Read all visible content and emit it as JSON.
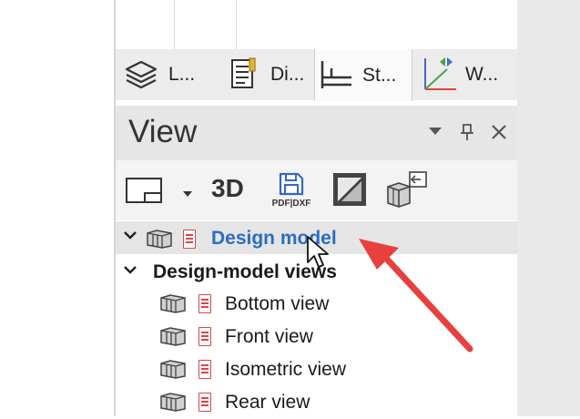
{
  "tabs": [
    {
      "label": "L...",
      "icon": "layers-icon"
    },
    {
      "label": "Di...",
      "icon": "document-icon"
    },
    {
      "label": "St...",
      "icon": "structure-icon",
      "active": true
    },
    {
      "label": "W...",
      "icon": "axes-icon"
    }
  ],
  "panel": {
    "title": "View",
    "menu_icon": "dropdown-arrow-icon",
    "pin_icon": "pin-icon",
    "close_icon": "close-icon"
  },
  "toolbar": {
    "view_frame_icon": "view-frame-icon",
    "three_d_label": "3D",
    "pdf_dxf_label": "PDF|DXF",
    "shading_icon": "shading-icon",
    "export_icon": "export-view-icon"
  },
  "tree": {
    "root_label": "Design model",
    "group_label": "Design-model views",
    "items": [
      {
        "label": "Bottom view"
      },
      {
        "label": "Front view"
      },
      {
        "label": "Isometric view"
      },
      {
        "label": "Rear view"
      }
    ]
  },
  "colors": {
    "link": "#2b6cc6",
    "arrow": "#e8403f",
    "doc_icon": "#d6464a"
  }
}
